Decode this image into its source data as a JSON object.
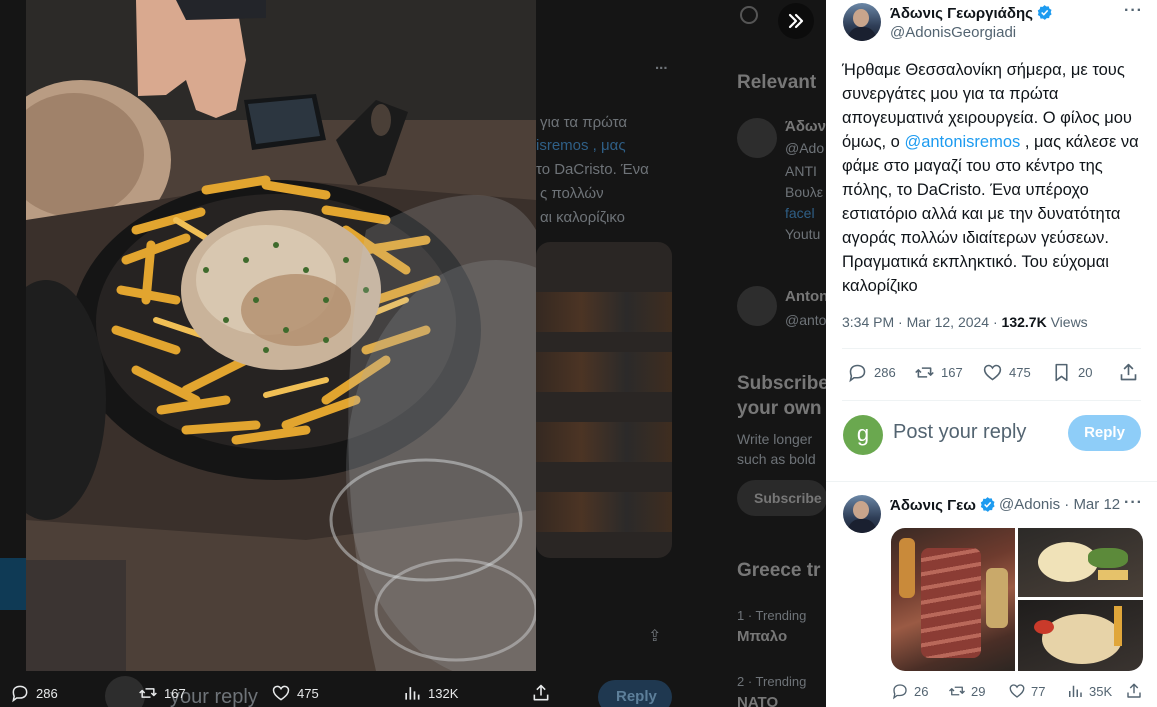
{
  "backdrop": {
    "relevant_label": "Relevant",
    "author_partial_1": "Άδων",
    "handle_partial": "@Ado",
    "bio_lines": [
      "ΑΝΤΙ",
      "Βουλε",
      "facel",
      "Youtu"
    ],
    "author_partial_2": "Anton",
    "handle_partial_2": "@anto",
    "tweet_lines": [
      "για τα πρώτα",
      "isremos , μας",
      "το DaCristo. Ένα",
      "ς πολλών",
      "αι καλορίζικο"
    ],
    "subscribe_title_1": "Subscribe",
    "subscribe_title_2": "your own",
    "subscribe_desc_1": "Write longer",
    "subscribe_desc_2": "such as bold",
    "subscribe_button": "Subscribe",
    "trends_title": "Greece tr",
    "trend_1_meta": "1 · Trending",
    "trend_1_name": "Μπαλο",
    "trend_2_meta": "2 · Trending",
    "trend_2_name": "NATO",
    "reply_placeholder": "your reply",
    "reply_button": "Reply",
    "more": "..."
  },
  "bottom_bar": {
    "replies": "286",
    "reposts": "167",
    "likes": "475",
    "views": "132K"
  },
  "main_tweet": {
    "author_name": "Άδωνις Γεωργιάδης",
    "author_handle": "@AdonisGeorgiadi",
    "text_before_mention": "Ήρθαμε Θεσσαλονίκη σήμερα, με τους συνεργάτες μου για τα πρώτα απογευματινά χειρουργεία. Ο φίλος μου όμως, ο ",
    "mention": "@antonisremos",
    "text_after_mention": " , μας κάλεσε να φάμε στο μαγαζί του στο κέντρο της πόλης, το DaCristo. Ένα υπέροχο εστιατόριο αλλά και με την δυνατότητα αγοράς πολλών ιδιαίτερων γεύσεων. Πραγματικά εκπληκτικό. Του εύχομαι καλορίζικο",
    "time": "3:34 PM",
    "date": "Mar 12, 2024",
    "views_count": "132.7K",
    "views_label": "Views",
    "replies": "286",
    "reposts": "167",
    "likes": "475",
    "bookmarks": "20"
  },
  "reply_box": {
    "avatar_letter": "g",
    "placeholder": "Post your reply",
    "button": "Reply"
  },
  "reply_tweet": {
    "author_name": "Άδωνις Γεω",
    "author_handle": "@Adonis",
    "date": "Mar 12",
    "replies": "26",
    "reposts": "29",
    "likes": "77",
    "views": "35K"
  },
  "colors": {
    "accent": "#1d9bf0",
    "reply_button_disabled": "#8ecdf8",
    "text_primary": "#0f1419",
    "text_secondary": "#536471",
    "avatar_g": "#6aa84f"
  },
  "icons": {
    "expand": "double-chevron-right-icon",
    "reply": "comment-icon",
    "repost": "repost-icon",
    "like": "heart-icon",
    "views": "bar-chart-icon",
    "share": "share-icon",
    "bookmark": "bookmark-icon",
    "verified": "verified-badge-icon",
    "more": "more-dots-icon"
  }
}
